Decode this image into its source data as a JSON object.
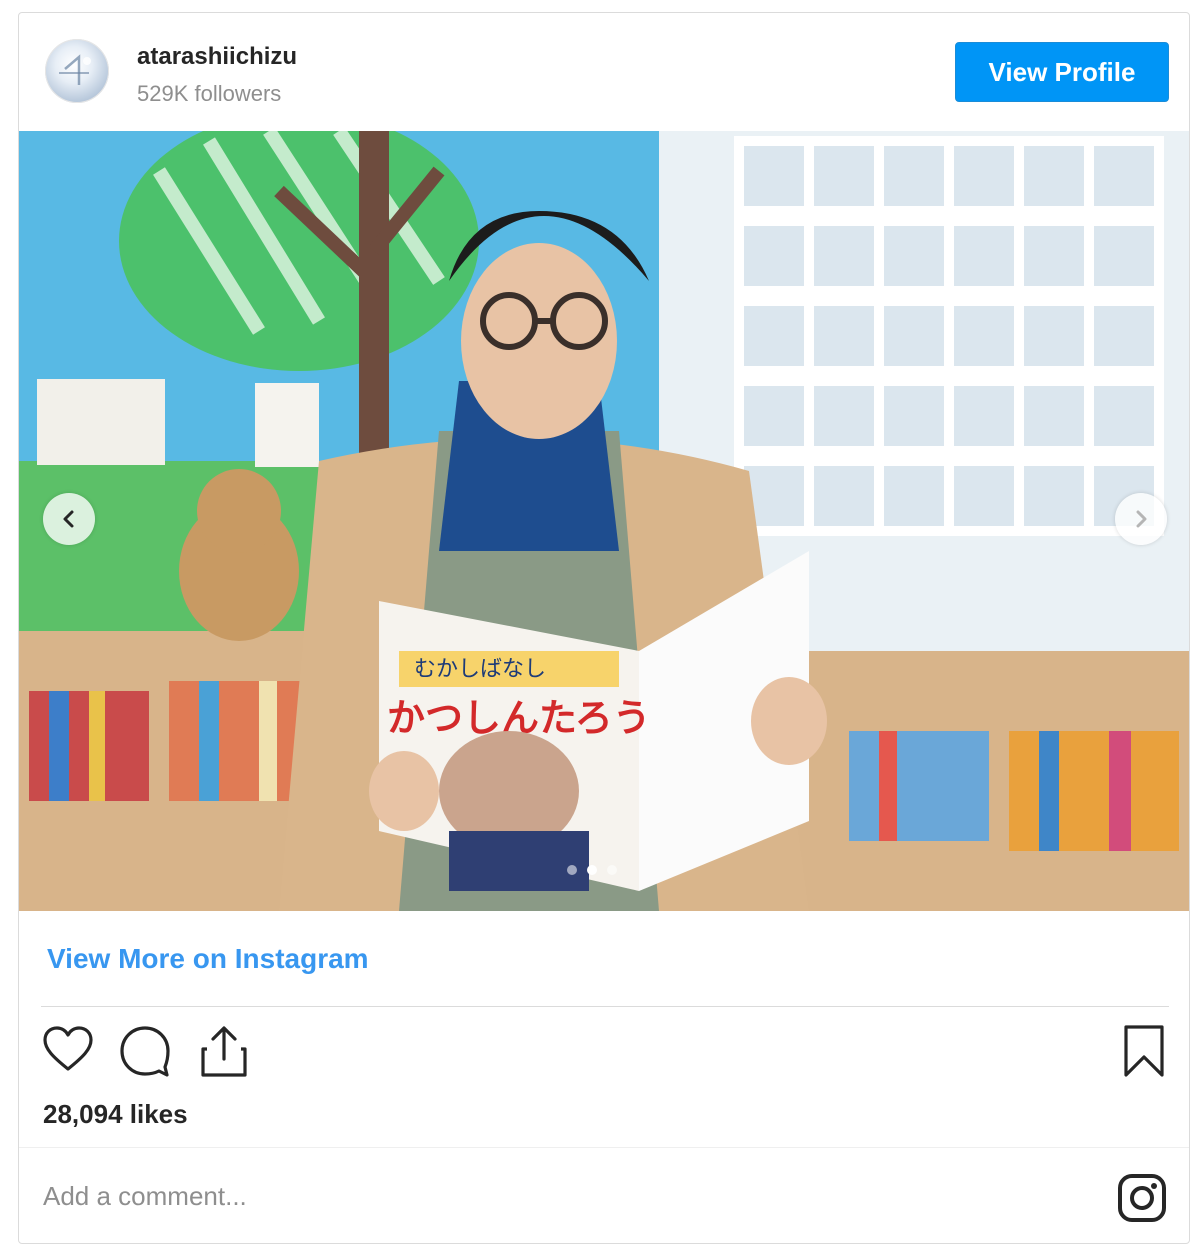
{
  "header": {
    "username": "atarashiichizu",
    "followers": "529K followers",
    "view_profile_label": "View Profile"
  },
  "post": {
    "image_alt": "Man with glasses reading a picture book in a library",
    "book_title": "かつしんたろう",
    "book_subtitle": "むかしばなし",
    "carousel": {
      "slides": 3,
      "active": 2
    }
  },
  "links": {
    "view_more": "View More on Instagram"
  },
  "actions": {
    "icons": [
      "heart-icon",
      "comment-icon",
      "share-icon",
      "bookmark-icon"
    ]
  },
  "stats": {
    "likes": "28,094 likes"
  },
  "comment": {
    "placeholder": "Add a comment..."
  },
  "colors": {
    "accent": "#0095f6",
    "link": "#3897f0",
    "border": "#dbdbdb"
  }
}
